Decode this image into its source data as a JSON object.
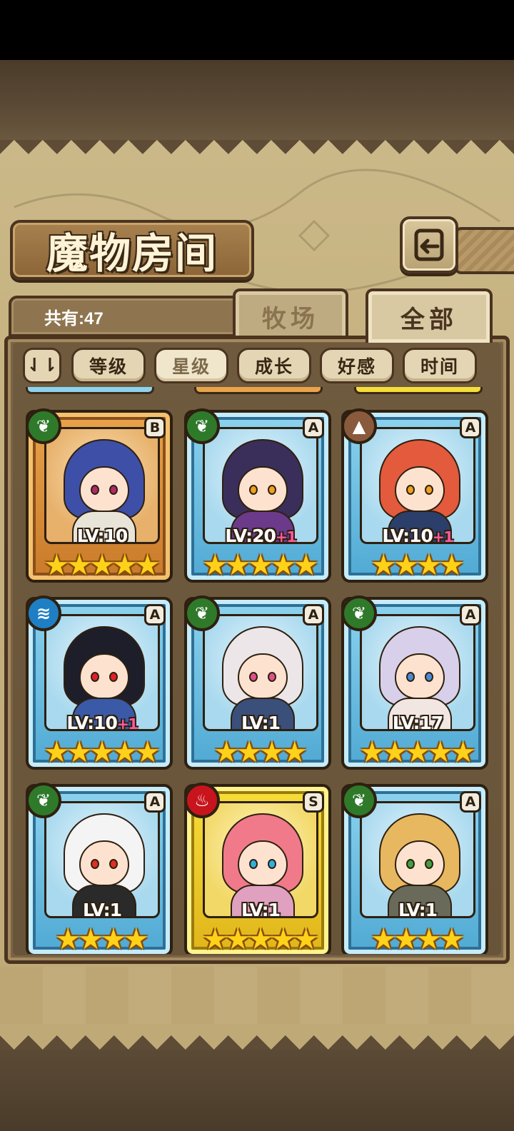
{
  "header": {
    "title": "魔物房间",
    "back_icon": "return-arrow-icon"
  },
  "summary": {
    "count_label": "共有:47"
  },
  "tabs": [
    {
      "label": "牧场",
      "active": false
    },
    {
      "label": "全部",
      "active": true
    }
  ],
  "sort": {
    "toggle_icon": "sort-order-icon",
    "toggle_glyph": "⇃⇂",
    "buttons": [
      {
        "label": "等级",
        "active": false
      },
      {
        "label": "星级",
        "active": true
      },
      {
        "label": "成长",
        "active": false
      },
      {
        "label": "好感",
        "active": false
      },
      {
        "label": "时间",
        "active": false
      }
    ]
  },
  "colors": {
    "nature": "#2f7a2a",
    "water": "#1f7fc4",
    "earth": "#8a5a3c",
    "fire": "#c8141c",
    "bonus": "#ff5a9c",
    "star": "#ffd21a"
  },
  "monsters": [
    {
      "rank": "B",
      "element": "nature",
      "level": "LV:10",
      "bonus": "",
      "stars": 5,
      "frame": "gold",
      "hair": "#3e4fa8",
      "eyes": "#b02b6a",
      "outfit": "#e8e4d8"
    },
    {
      "rank": "A",
      "element": "nature",
      "level": "LV:20",
      "bonus": "+1",
      "stars": 5,
      "frame": "blue",
      "hair": "#3a2f5a",
      "eyes": "#f0a020",
      "outfit": "#6b3a8a"
    },
    {
      "rank": "A",
      "element": "earth",
      "level": "LV:10",
      "bonus": "+1",
      "stars": 4,
      "frame": "blue",
      "hair": "#e35a3c",
      "eyes": "#f0a020",
      "outfit": "#2c3f6a"
    },
    {
      "rank": "A",
      "element": "water",
      "level": "LV:10",
      "bonus": "+1",
      "stars": 5,
      "frame": "blue",
      "hair": "#1e1e2a",
      "eyes": "#e0202a",
      "outfit": "#3a5aa8"
    },
    {
      "rank": "A",
      "element": "nature",
      "level": "LV:1",
      "bonus": "",
      "stars": 4,
      "frame": "blue",
      "hair": "#ece6e8",
      "eyes": "#e0508a",
      "outfit": "#3a4f7a"
    },
    {
      "rank": "A",
      "element": "nature",
      "level": "LV:17",
      "bonus": "",
      "stars": 5,
      "frame": "blue",
      "hair": "#d8d0ea",
      "eyes": "#4a8ad8",
      "outfit": "#f2e6e2"
    },
    {
      "rank": "A",
      "element": "nature",
      "level": "LV:1",
      "bonus": "",
      "stars": 4,
      "frame": "blue",
      "hair": "#f4f4f4",
      "eyes": "#e03020",
      "outfit": "#2a2a2a"
    },
    {
      "rank": "S",
      "element": "fire",
      "level": "LV:1",
      "bonus": "",
      "stars": 5,
      "frame": "yellow",
      "hair": "#f07a8a",
      "eyes": "#30b0e0",
      "outfit": "#e0a0c0"
    },
    {
      "rank": "A",
      "element": "nature",
      "level": "LV:1",
      "bonus": "",
      "stars": 4,
      "frame": "blue",
      "hair": "#e8b860",
      "eyes": "#40a040",
      "outfit": "#6a6a5a"
    }
  ]
}
